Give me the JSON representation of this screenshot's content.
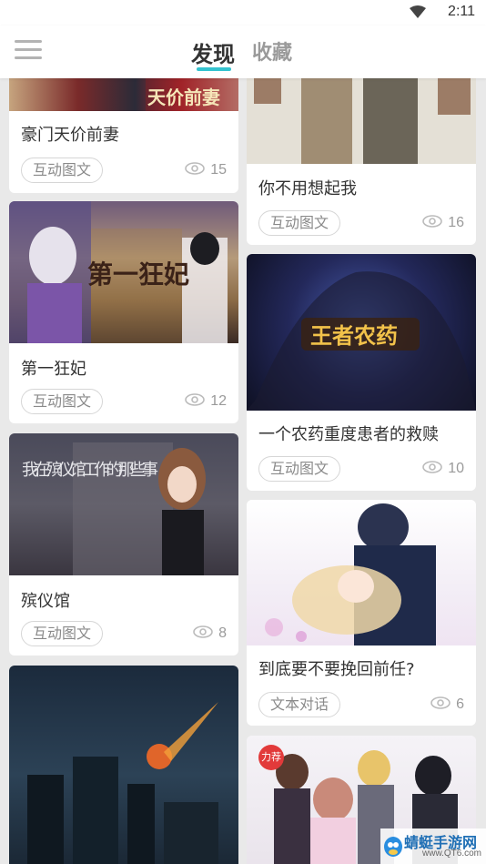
{
  "status_bar": {
    "time": "2:11"
  },
  "header": {
    "tabs": [
      {
        "label": "发现"
      },
      {
        "label": "收藏"
      }
    ]
  },
  "cards": [
    {
      "title": "豪门天价前妻",
      "tag": "互动图文",
      "views": "15",
      "cover_text": "天价前妻"
    },
    {
      "title": "你不用想起我",
      "tag": "互动图文",
      "views": "16"
    },
    {
      "title": "第一狂妃",
      "tag": "互动图文",
      "views": "12",
      "cover_text": "第一狂妃"
    },
    {
      "title": "一个农药重度患者的救赎",
      "tag": "互动图文",
      "views": "10",
      "cover_text": "王者农药"
    },
    {
      "title": "殡仪馆",
      "tag": "互动图文",
      "views": "8",
      "cover_text": "我在殡仪馆工作的那些事"
    },
    {
      "title": "到底要不要挽回前任?",
      "tag": "文本对话",
      "views": "6"
    },
    {
      "badge": "力荐"
    }
  ],
  "watermark": {
    "text": "蜻蜓手游网",
    "url": "www.QT6.com"
  },
  "colors": {
    "accent": "#34c3cf"
  }
}
